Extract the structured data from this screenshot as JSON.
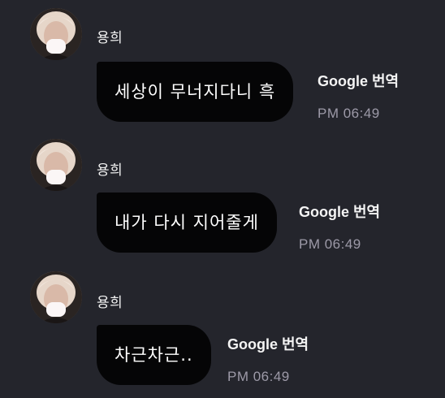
{
  "messages": [
    {
      "sender": "용희",
      "text": "세상이 무너지다니 흑",
      "translate_label": "Google 번역",
      "time": "PM 06:49",
      "avatar_icon": "user-avatar-photo"
    },
    {
      "sender": "용희",
      "text": "내가 다시 지어줄게",
      "translate_label": "Google 번역",
      "time": "PM 06:49",
      "avatar_icon": "user-avatar-photo"
    },
    {
      "sender": "용희",
      "text": "차근차근..",
      "translate_label": "Google 번역",
      "time": "PM 06:49",
      "avatar_icon": "user-avatar-photo"
    }
  ],
  "colors": {
    "background": "#24252c",
    "bubble": "#050506",
    "time": "#9d9aa8"
  }
}
